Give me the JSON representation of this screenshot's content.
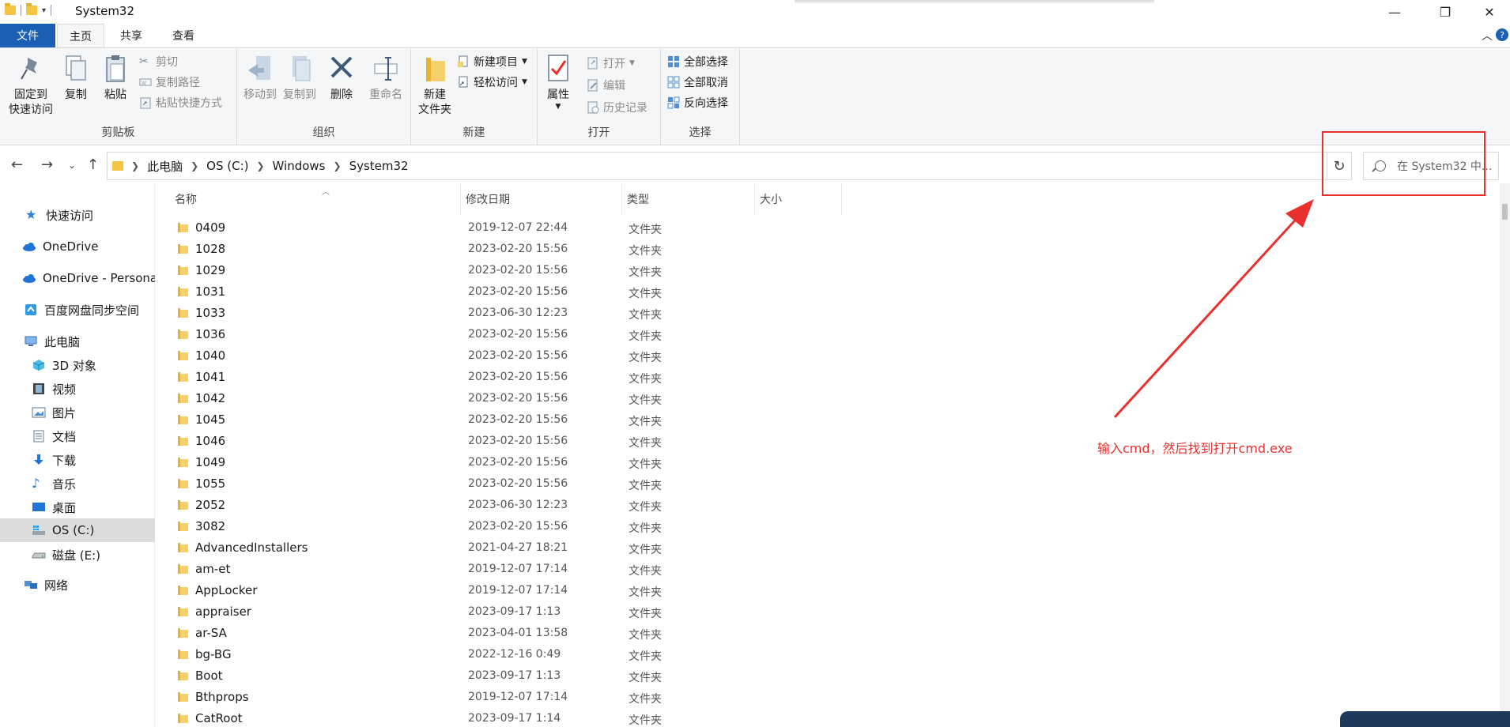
{
  "window": {
    "title": "System32",
    "minimize_glyph": "—",
    "maximize_glyph": "❐",
    "close_glyph": "✕"
  },
  "ribbon_tabs": [
    {
      "label": "文件"
    },
    {
      "label": "主页"
    },
    {
      "label": "共享"
    },
    {
      "label": "查看"
    }
  ],
  "ribbon": {
    "clipboard": {
      "group_label": "剪贴板",
      "pin_line1": "固定到",
      "pin_line2": "快速访问",
      "copy": "复制",
      "paste": "粘贴",
      "cut": "剪切",
      "copy_path": "复制路径",
      "paste_shortcut": "粘贴快捷方式"
    },
    "organize": {
      "group_label": "组织",
      "move_to": "移动到",
      "copy_to": "复制到",
      "delete": "删除",
      "rename": "重命名"
    },
    "new": {
      "group_label": "新建",
      "new_folder_line1": "新建",
      "new_folder_line2": "文件夹",
      "new_item": "新建项目",
      "easy_access": "轻松访问"
    },
    "open": {
      "group_label": "打开",
      "properties": "属性",
      "open": "打开",
      "edit": "编辑",
      "history": "历史记录"
    },
    "select": {
      "group_label": "选择",
      "select_all": "全部选择",
      "select_none": "全部取消",
      "invert": "反向选择"
    }
  },
  "address": {
    "crumbs": [
      "此电脑",
      "OS (C:)",
      "Windows",
      "System32"
    ],
    "search_placeholder": "在 System32 中..."
  },
  "sidebar": {
    "items": [
      {
        "label": "快速访问",
        "icon": "star-icon"
      },
      {
        "label": "OneDrive",
        "icon": "cloud-icon"
      },
      {
        "label": "OneDrive - Persona",
        "icon": "cloud-icon"
      },
      {
        "label": "百度网盘同步空间",
        "icon": "baidu-netdisk-icon"
      },
      {
        "label": "此电脑",
        "icon": "computer-icon"
      },
      {
        "label": "3D 对象",
        "icon": "cube-icon"
      },
      {
        "label": "视频",
        "icon": "film-icon"
      },
      {
        "label": "图片",
        "icon": "picture-icon"
      },
      {
        "label": "文档",
        "icon": "document-icon"
      },
      {
        "label": "下载",
        "icon": "download-icon"
      },
      {
        "label": "音乐",
        "icon": "music-icon"
      },
      {
        "label": "桌面",
        "icon": "desktop-icon"
      },
      {
        "label": "OS (C:)",
        "icon": "os-drive-icon"
      },
      {
        "label": "磁盘 (E:)",
        "icon": "drive-icon"
      },
      {
        "label": "网络",
        "icon": "network-icon"
      }
    ]
  },
  "columns": {
    "name": "名称",
    "date": "修改日期",
    "type": "类型",
    "size": "大小"
  },
  "files": [
    {
      "name": "0409",
      "date": "2019-12-07 22:44",
      "type": "文件夹"
    },
    {
      "name": "1028",
      "date": "2023-02-20 15:56",
      "type": "文件夹"
    },
    {
      "name": "1029",
      "date": "2023-02-20 15:56",
      "type": "文件夹"
    },
    {
      "name": "1031",
      "date": "2023-02-20 15:56",
      "type": "文件夹"
    },
    {
      "name": "1033",
      "date": "2023-06-30 12:23",
      "type": "文件夹"
    },
    {
      "name": "1036",
      "date": "2023-02-20 15:56",
      "type": "文件夹"
    },
    {
      "name": "1040",
      "date": "2023-02-20 15:56",
      "type": "文件夹"
    },
    {
      "name": "1041",
      "date": "2023-02-20 15:56",
      "type": "文件夹"
    },
    {
      "name": "1042",
      "date": "2023-02-20 15:56",
      "type": "文件夹"
    },
    {
      "name": "1045",
      "date": "2023-02-20 15:56",
      "type": "文件夹"
    },
    {
      "name": "1046",
      "date": "2023-02-20 15:56",
      "type": "文件夹"
    },
    {
      "name": "1049",
      "date": "2023-02-20 15:56",
      "type": "文件夹"
    },
    {
      "name": "1055",
      "date": "2023-02-20 15:56",
      "type": "文件夹"
    },
    {
      "name": "2052",
      "date": "2023-06-30 12:23",
      "type": "文件夹"
    },
    {
      "name": "3082",
      "date": "2023-02-20 15:56",
      "type": "文件夹"
    },
    {
      "name": "AdvancedInstallers",
      "date": "2021-04-27 18:21",
      "type": "文件夹"
    },
    {
      "name": "am-et",
      "date": "2019-12-07 17:14",
      "type": "文件夹"
    },
    {
      "name": "AppLocker",
      "date": "2019-12-07 17:14",
      "type": "文件夹"
    },
    {
      "name": "appraiser",
      "date": "2023-09-17 1:13",
      "type": "文件夹"
    },
    {
      "name": "ar-SA",
      "date": "2023-04-01 13:58",
      "type": "文件夹"
    },
    {
      "name": "bg-BG",
      "date": "2022-12-16 0:49",
      "type": "文件夹"
    },
    {
      "name": "Boot",
      "date": "2023-09-17 1:13",
      "type": "文件夹"
    },
    {
      "name": "Bthprops",
      "date": "2019-12-07 17:14",
      "type": "文件夹"
    },
    {
      "name": "CatRoot",
      "date": "2023-09-17 1:14",
      "type": "文件夹"
    }
  ],
  "annotation": {
    "text": "输入cmd，然后找到打开cmd.exe",
    "color": "#e8302f"
  },
  "colors": {
    "accent": "#1a5fb4",
    "folder": "#f6d06a",
    "annotation": "#e8302f"
  }
}
